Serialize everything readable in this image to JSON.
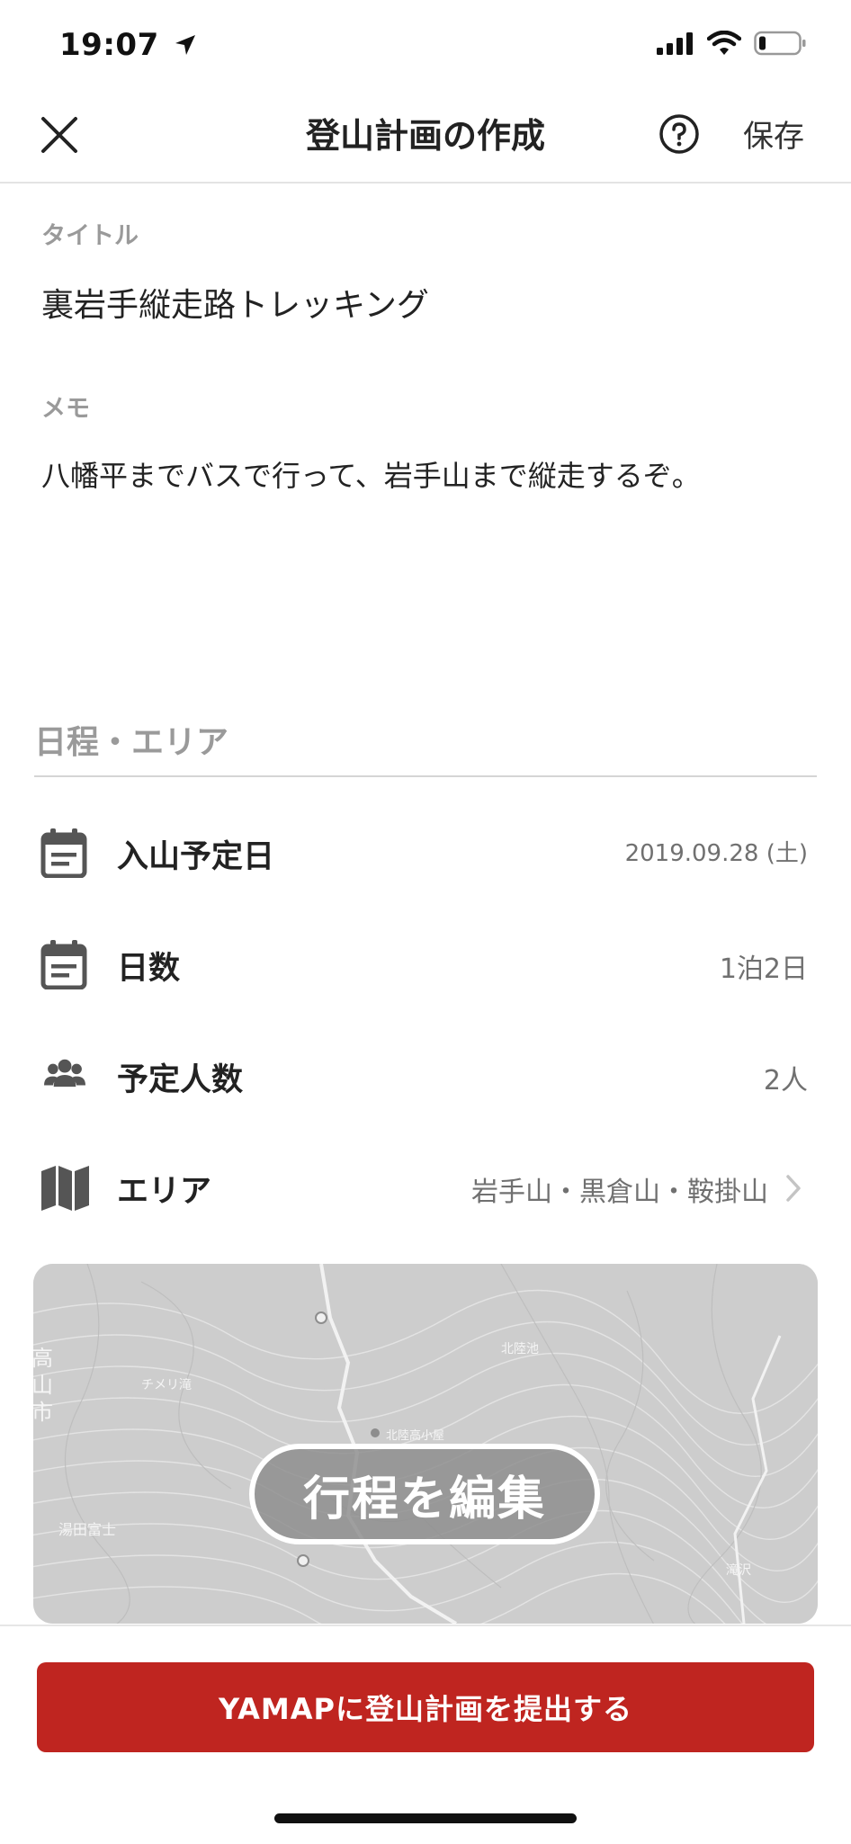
{
  "status_bar": {
    "time": "19:07"
  },
  "nav": {
    "title": "登山計画の作成",
    "save_label": "保存"
  },
  "form": {
    "title_label": "タイトル",
    "title_value": "裏岩手縦走路トレッキング",
    "memo_label": "メモ",
    "memo_value": "八幡平までバスで行って、岩手山まで縦走するぞ。"
  },
  "schedule": {
    "section_title": "日程・エリア",
    "rows": [
      {
        "label": "入山予定日",
        "value": "2019.09.28 (土)",
        "icon": "calendar-icon"
      },
      {
        "label": "日数",
        "value": "1泊2日",
        "icon": "calendar-icon"
      },
      {
        "label": "予定人数",
        "value": "2人",
        "icon": "people-icon"
      },
      {
        "label": "エリア",
        "value": "岩手山・黒倉山・鞍掛山",
        "icon": "map-icon"
      }
    ]
  },
  "map": {
    "edit_label": "行程を編集",
    "labels": [
      "高山市",
      "チメリ滝",
      "北陸池",
      "北陸高小屋",
      "湯田富士",
      "滝沢"
    ]
  },
  "footer": {
    "submit_label": "YAMAPに登山計画を提出する"
  },
  "colors": {
    "accent_red": "#bf2520",
    "label_gray": "#9a9a9a",
    "map_gray": "#cfcfcf"
  }
}
